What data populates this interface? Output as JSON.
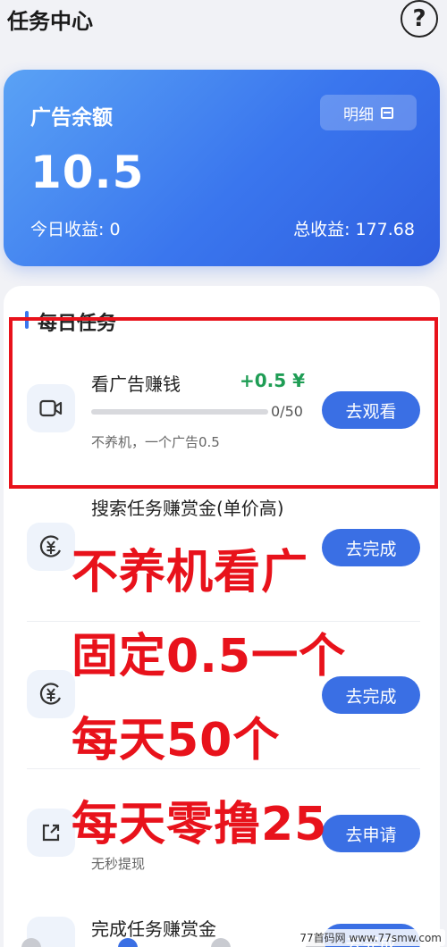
{
  "header": {
    "title": "任务中心",
    "help_icon": "?"
  },
  "balance": {
    "title": "广告余额",
    "detail_label": "明细",
    "value": "10.5",
    "today": "今日收益: 0",
    "total": "总收益: 177.68"
  },
  "tasks": {
    "section_title": "每日任务",
    "items": [
      {
        "name": "看广告赚钱",
        "reward": "+0.5 ¥",
        "progress_label": "0/50",
        "progress": 0,
        "desc": "不养机，一个广告0.5",
        "action": "去观看",
        "icon": "video-icon"
      },
      {
        "name": "搜索任务赚赏金(单价高)",
        "action": "去完成",
        "icon": "yuan-icon"
      },
      {
        "action": "去完成",
        "icon": "yuan-icon"
      },
      {
        "desc": "无秒提现",
        "action": "去申请",
        "icon": "share-icon"
      },
      {
        "name": "完成任务赚赏金",
        "action": "去完成",
        "icon": "yuan-icon"
      }
    ]
  },
  "overlay": {
    "lines": [
      "不养机看广",
      "固定0.5一个",
      "每天50个",
      "每天零撸25"
    ]
  },
  "watermark": "77首码网 www.77smw.com",
  "colors": {
    "accent": "#3a6fe4",
    "reward_green": "#1f9d55",
    "overlay_red": "#e8121b"
  }
}
